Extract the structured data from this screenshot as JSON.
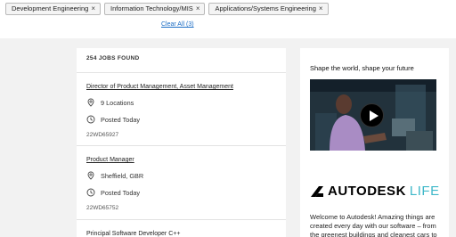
{
  "filters": {
    "chips": [
      {
        "label": "Development Engineering"
      },
      {
        "label": "Information Technology/MIS"
      },
      {
        "label": "Applications/Systems Engineering"
      }
    ],
    "remove_glyph": "×",
    "clear_all": "Clear All (3)"
  },
  "results": {
    "count_label": "254 JOBS FOUND",
    "jobs": [
      {
        "title": "Director of Product Management, Asset Management",
        "location": "9 Locations",
        "posted": "Posted Today",
        "id": "22WD65927"
      },
      {
        "title": "Product Manager",
        "location": "Sheffield, GBR",
        "posted": "Posted Today",
        "id": "22WD65752"
      },
      {
        "title": "Principal Software Developer C++"
      }
    ]
  },
  "sidebar": {
    "tagline": "Shape the world, shape your future",
    "logo_word": "AUTODESK",
    "logo_suffix": "LIFE",
    "blurb": "Welcome to Autodesk! Amazing things are created every day with our software – from the greenest buildings and cleanest cars to the smartest factories"
  },
  "colors": {
    "link": "#1a6cc4",
    "life": "#3fb8c9",
    "page_bg": "#f2f2f2"
  }
}
